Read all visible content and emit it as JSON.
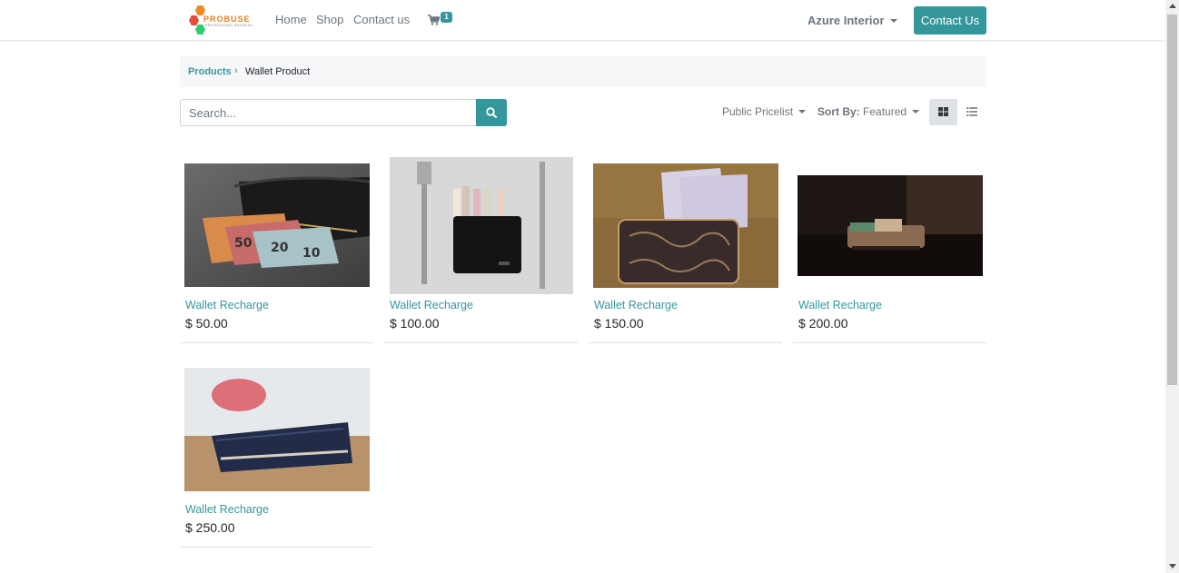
{
  "header": {
    "brand": "PROBUSE",
    "brand_tagline": "PROFESSIONAL BUSINESS",
    "nav": {
      "home": "Home",
      "shop": "Shop",
      "contact": "Contact us"
    },
    "cart_count": "1",
    "user_name": "Azure Interior",
    "contact_button": "Contact Us"
  },
  "breadcrumb": {
    "parent": "Products",
    "current": "Wallet Product"
  },
  "search": {
    "placeholder": "Search...",
    "value": ""
  },
  "toolbar": {
    "pricelist": "Public Pricelist",
    "sort_label": "Sort By:",
    "sort_value": "Featured",
    "active_view": "grid"
  },
  "products": [
    {
      "name": "Wallet Recharge",
      "price": "$ 50.00",
      "image": "wallet-with-euro-notes"
    },
    {
      "name": "Wallet Recharge",
      "price": "$ 100.00",
      "image": "black-wallet-fork-knife"
    },
    {
      "name": "Wallet Recharge",
      "price": "$ 150.00",
      "image": "patterned-wallet-500-notes"
    },
    {
      "name": "Wallet Recharge",
      "price": "$ 200.00",
      "image": "leather-wallet-dark-table"
    },
    {
      "name": "Wallet Recharge",
      "price": "$ 250.00",
      "image": "navy-wallet-table"
    }
  ],
  "colors": {
    "accent": "#35979c",
    "breadcrumb_bg": "#f6f7f9"
  }
}
